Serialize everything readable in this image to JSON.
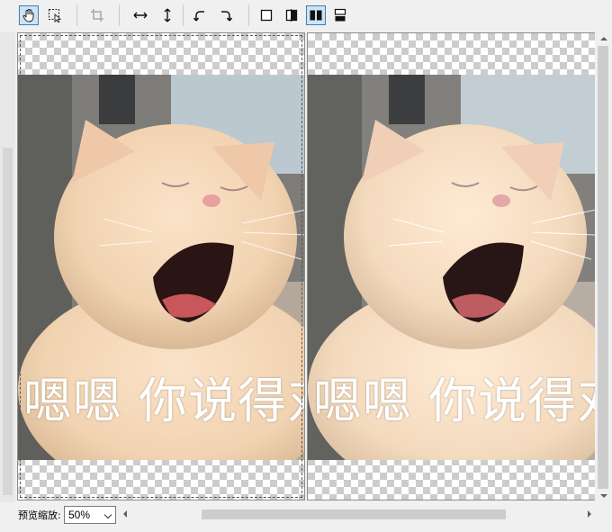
{
  "toolbar": {
    "tools": [
      {
        "name": "hand-tool",
        "icon": "hand-icon",
        "active": true
      },
      {
        "name": "select-tool",
        "icon": "marquee-select-icon",
        "active": false
      },
      {
        "name": "crop-tool",
        "icon": "crop-icon",
        "disabled": true
      },
      {
        "name": "flip-horizontal",
        "icon": "flip-horizontal-icon"
      },
      {
        "name": "flip-vertical",
        "icon": "flip-vertical-icon"
      },
      {
        "name": "rotate-left",
        "icon": "rotate-left-icon"
      },
      {
        "name": "rotate-right",
        "icon": "rotate-right-icon"
      },
      {
        "name": "single-view",
        "icon": "single-view-icon"
      },
      {
        "name": "compare-split",
        "icon": "compare-split-icon"
      },
      {
        "name": "side-by-side",
        "icon": "side-by-side-icon",
        "active": true
      },
      {
        "name": "top-bottom",
        "icon": "top-bottom-icon"
      }
    ]
  },
  "preview": {
    "caption_text": "嗯嗯 你说得对",
    "left_pane": "original",
    "right_pane": "result",
    "background": "transparent-checkerboard"
  },
  "bottom": {
    "zoom_label": "预览缩放:",
    "zoom_value": "50%"
  },
  "colors": {
    "accent": "#3c7fb1",
    "active_bg": "#cce4f7",
    "checker_dark": "#cccccc",
    "checker_light": "#ffffff"
  }
}
